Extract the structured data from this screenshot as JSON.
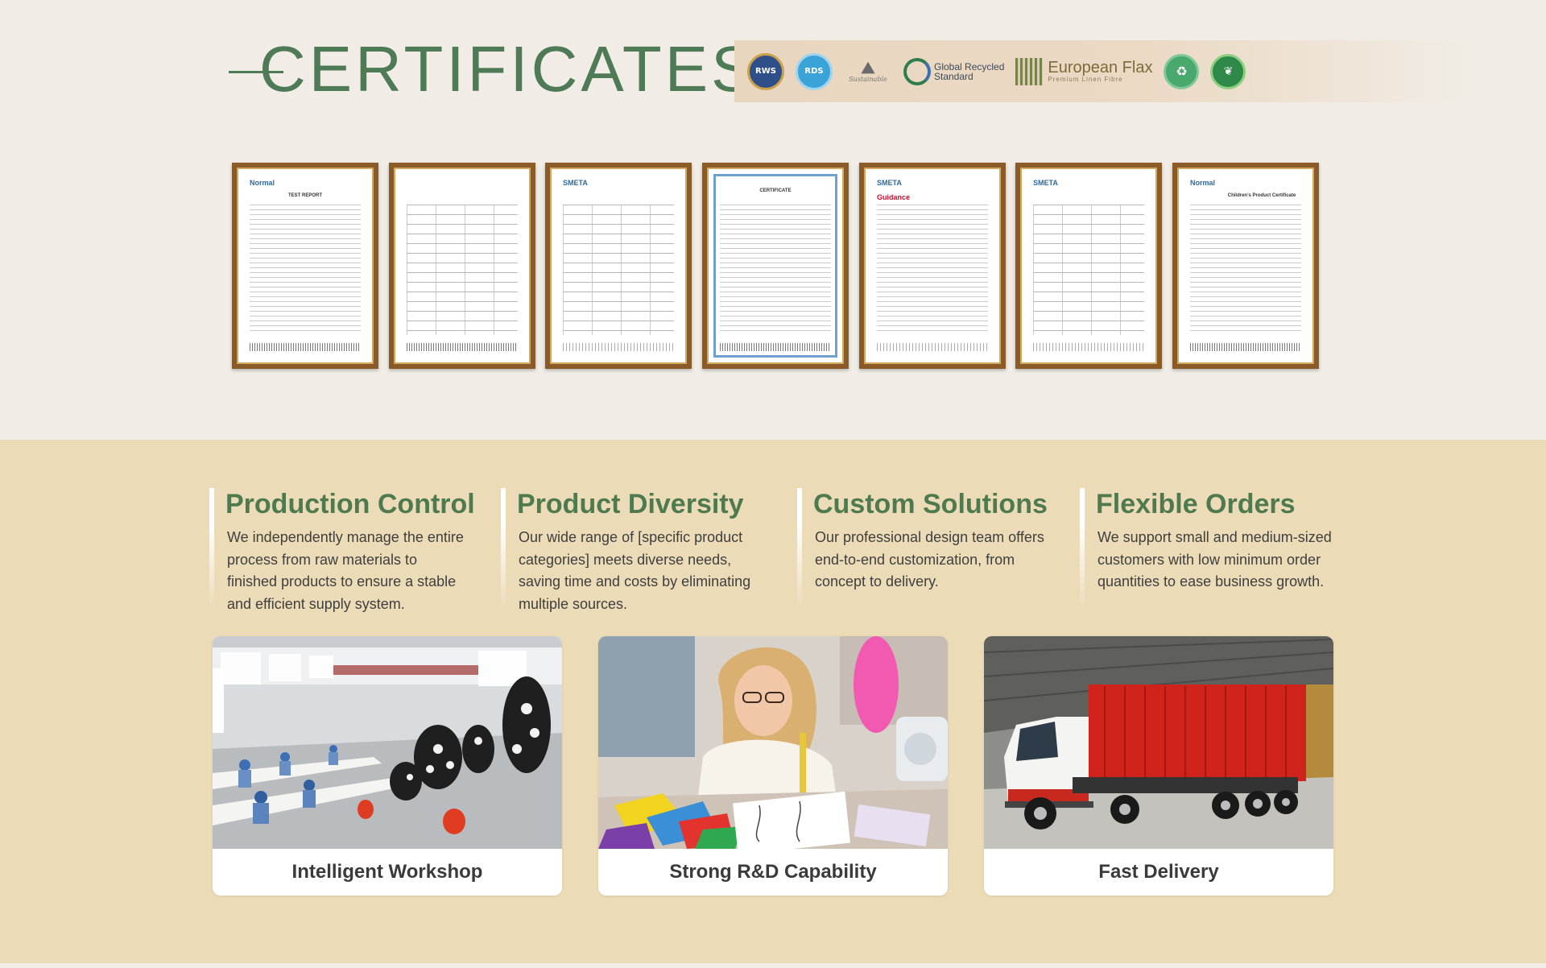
{
  "certificates": {
    "title": "CERTIFICATES",
    "logos": [
      {
        "icon": "rws-badge-icon",
        "text": "RWS"
      },
      {
        "icon": "rds-badge-icon",
        "text": "RDS"
      },
      {
        "icon": "sustainable-icon",
        "text": "Sustainable"
      },
      {
        "icon": "global-recycled-standard-icon",
        "text": "Global Recycled\nStandard"
      },
      {
        "icon": "european-flax-icon",
        "text": "European Flax",
        "sub": "Premium Linen Fibre"
      },
      {
        "icon": "recycled-badge-icon",
        "text": ""
      },
      {
        "icon": "organic-badge-icon",
        "text": ""
      }
    ],
    "documents": [
      {
        "header": "Normal",
        "heading": "TEST REPORT",
        "style": "lines"
      },
      {
        "header": "",
        "heading": "",
        "style": "lines"
      },
      {
        "header": "SMETA",
        "heading": "",
        "style": "table"
      },
      {
        "header": "",
        "heading": "CERTIFICATE",
        "style": "lines"
      },
      {
        "header": "SMETA",
        "heading": "Guidance",
        "style": "lines"
      },
      {
        "header": "SMETA",
        "heading": "",
        "style": "table"
      },
      {
        "header": "Normal",
        "heading": "Children's Product Certificate",
        "style": "lines"
      }
    ]
  },
  "features": [
    {
      "title": "Production Control",
      "text": "We independently manage the entire process from raw materials to finished products to ensure a stable and efficient supply system."
    },
    {
      "title": "Product Diversity",
      "text": "Our wide range of [specific product categories] meets diverse needs, saving time and costs by eliminating multiple sources."
    },
    {
      "title": "Custom Solutions",
      "text": "Our professional design team offers end-to-end customization, from concept to delivery."
    },
    {
      "title": "Flexible Orders",
      "text": "We support small and medium-sized customers with low minimum order quantities to ease business growth."
    }
  ],
  "cards": [
    {
      "caption": "Intelligent Workshop",
      "image": "garment-factory-workshop-photo"
    },
    {
      "caption": "Strong R&D Capability",
      "image": "designer-sketching-photo"
    },
    {
      "caption": "Fast Delivery",
      "image": "red-container-truck-photo"
    }
  ],
  "colors": {
    "brand_green": "#4e7a56",
    "feature_bg": "#ecdbb7",
    "certificate_bg": "#f1ede6",
    "frame_gold": "#8a5a28"
  }
}
